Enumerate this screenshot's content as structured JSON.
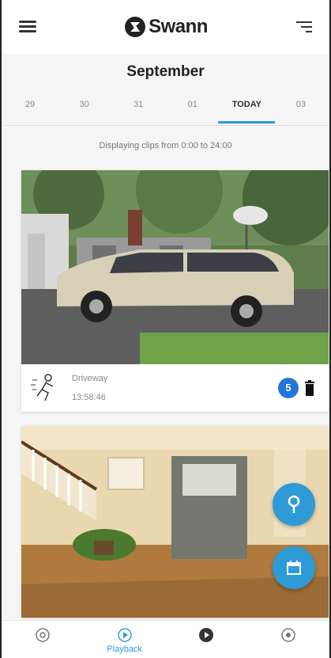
{
  "header": {
    "brand": "Swann",
    "menu_icon": "hamburger-menu-icon",
    "filter_icon": "filter-icon"
  },
  "calendar": {
    "month": "September",
    "dates": [
      "29",
      "30",
      "31",
      "01",
      "TODAY",
      "03"
    ],
    "selected": "TODAY"
  },
  "info_text": "Displaying clips from 0:00 to 24:00",
  "clips": [
    {
      "title": "Driveway",
      "time": "13:58:46",
      "count": "5",
      "icon": "motion-person-icon",
      "thumbnail": "minivan-in-driveway"
    },
    {
      "thumbnail": "house-interior-hallway"
    }
  ],
  "fabs": [
    {
      "icon": "location-pin-icon"
    },
    {
      "icon": "calendar-icon"
    }
  ],
  "bottom_nav": {
    "items": [
      {
        "icon": "home-icon",
        "label": ""
      },
      {
        "icon": "playback-icon",
        "label": "Playback",
        "active": true
      },
      {
        "icon": "record-icon",
        "label": ""
      },
      {
        "icon": "settings-icon",
        "label": ""
      }
    ]
  },
  "colors": {
    "accent": "#2e9bd6",
    "badge": "#2176d8",
    "background": "#f5f5f5"
  }
}
